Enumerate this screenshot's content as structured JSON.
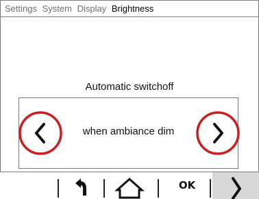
{
  "breadcrumb": {
    "items": [
      "Settings",
      "System",
      "Display"
    ],
    "current": "Brightness"
  },
  "setting": {
    "title": "Automatic switchoff",
    "value": "when ambiance dim"
  },
  "controls": {
    "highlight_color": "#cc1e1e",
    "prev_icon": "chevron-left-icon",
    "next_icon": "chevron-right-icon"
  },
  "bottom_bar": {
    "back_icon": "back-arrow-icon",
    "home_icon": "home-icon",
    "ok_label": "OK",
    "next_icon": "chevron-right-icon",
    "next_bg": "#d8d8d8"
  }
}
